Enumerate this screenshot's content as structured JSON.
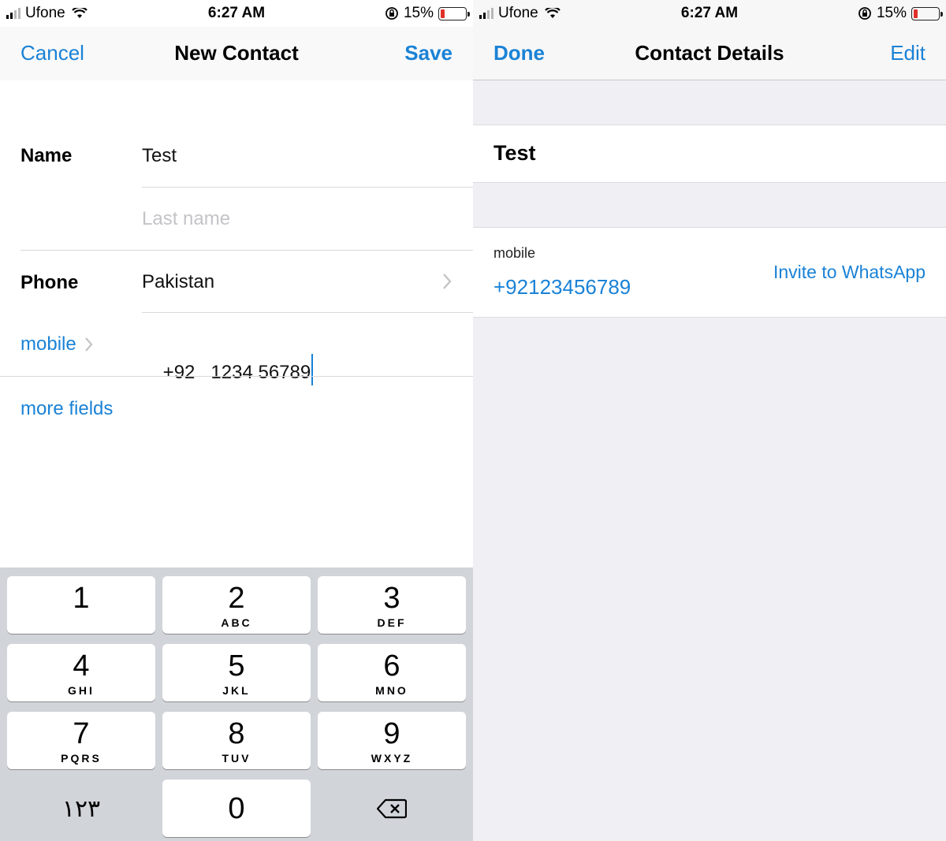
{
  "status_bar": {
    "carrier": "Ufone",
    "time": "6:27 AM",
    "battery_percent": "15%",
    "battery_level": 0.15
  },
  "new_contact": {
    "nav": {
      "cancel_label": "Cancel",
      "title": "New Contact",
      "save_label": "Save"
    },
    "name_label": "Name",
    "first_name_value": "Test",
    "last_name_placeholder": "Last name",
    "phone_label": "Phone",
    "country_value": "Pakistan",
    "phone_type_label": "mobile",
    "country_code": "+92",
    "phone_number": "1234 56789",
    "more_fields_label": "more fields"
  },
  "keypad": {
    "keys": [
      {
        "num": "1",
        "letters": ""
      },
      {
        "num": "2",
        "letters": "ABC"
      },
      {
        "num": "3",
        "letters": "DEF"
      },
      {
        "num": "4",
        "letters": "GHI"
      },
      {
        "num": "5",
        "letters": "JKL"
      },
      {
        "num": "6",
        "letters": "MNO"
      },
      {
        "num": "7",
        "letters": "PQRS"
      },
      {
        "num": "8",
        "letters": "TUV"
      },
      {
        "num": "9",
        "letters": "WXYZ"
      }
    ],
    "symbols_key": "١٢٣",
    "zero_key": "0",
    "delete_icon": "backspace-icon"
  },
  "contact_details": {
    "nav": {
      "done_label": "Done",
      "title": "Contact Details",
      "edit_label": "Edit"
    },
    "name": "Test",
    "phone_type": "mobile",
    "phone_number": "+92123456789",
    "invite_label": "Invite to WhatsApp"
  },
  "colors": {
    "accent": "#1a82d6",
    "keypad_bg": "#d1d4d9",
    "grouped_bg": "#efeff4",
    "battery_low": "#e0302a"
  }
}
